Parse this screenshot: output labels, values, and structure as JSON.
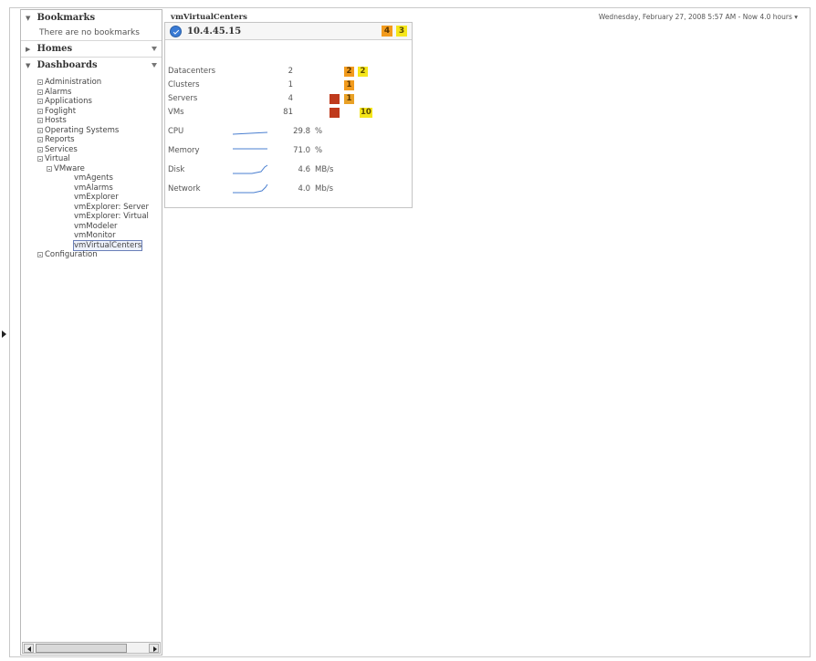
{
  "sidebar": {
    "bookmarks": {
      "title": "Bookmarks",
      "empty_text": "There are no bookmarks"
    },
    "homes": {
      "title": "Homes"
    },
    "dashboards": {
      "title": "Dashboards",
      "items": [
        "Administration",
        "Alarms",
        "Applications",
        "Foglight",
        "Hosts",
        "Operating Systems",
        "Reports",
        "Services",
        "Virtual"
      ],
      "vmware": {
        "label": "VMware",
        "children": [
          "vmAgents",
          "vmAlarms",
          "vmExplorer",
          "vmExplorer: Server",
          "vmExplorer: Virtual",
          "vmModeler",
          "vmMonitor",
          "vmVirtualCenters"
        ]
      },
      "configuration": "Configuration"
    }
  },
  "main": {
    "title": "vmVirtualCenters",
    "timestamp": "Wednesday, February 27, 2008 5:57 AM - Now 4.0 hours ▾",
    "card": {
      "host": "10.4.45.15",
      "header_badges": [
        "4",
        "3"
      ],
      "counts": [
        {
          "label": "Datacenters",
          "value": "2",
          "badges": [
            "2",
            "2"
          ]
        },
        {
          "label": "Clusters",
          "value": "1",
          "badges": [
            "1"
          ]
        },
        {
          "label": "Servers",
          "value": "4",
          "badges": [
            "",
            "1"
          ]
        },
        {
          "label": "VMs",
          "value": "81",
          "badges": [
            "",
            "10"
          ]
        }
      ],
      "usage": [
        {
          "label": "CPU",
          "value": "29.8",
          "unit": "%"
        },
        {
          "label": "Memory",
          "value": "71.0",
          "unit": "%"
        },
        {
          "label": "Disk",
          "value": "4.6",
          "unit": "MB/s"
        },
        {
          "label": "Network",
          "value": "4.0",
          "unit": "Mb/s"
        }
      ]
    }
  },
  "colors": {
    "critical": "#bf3a1c",
    "warning": "#f29b1d",
    "fatal": "#f5e61a",
    "accent": "#3a7bd5"
  }
}
